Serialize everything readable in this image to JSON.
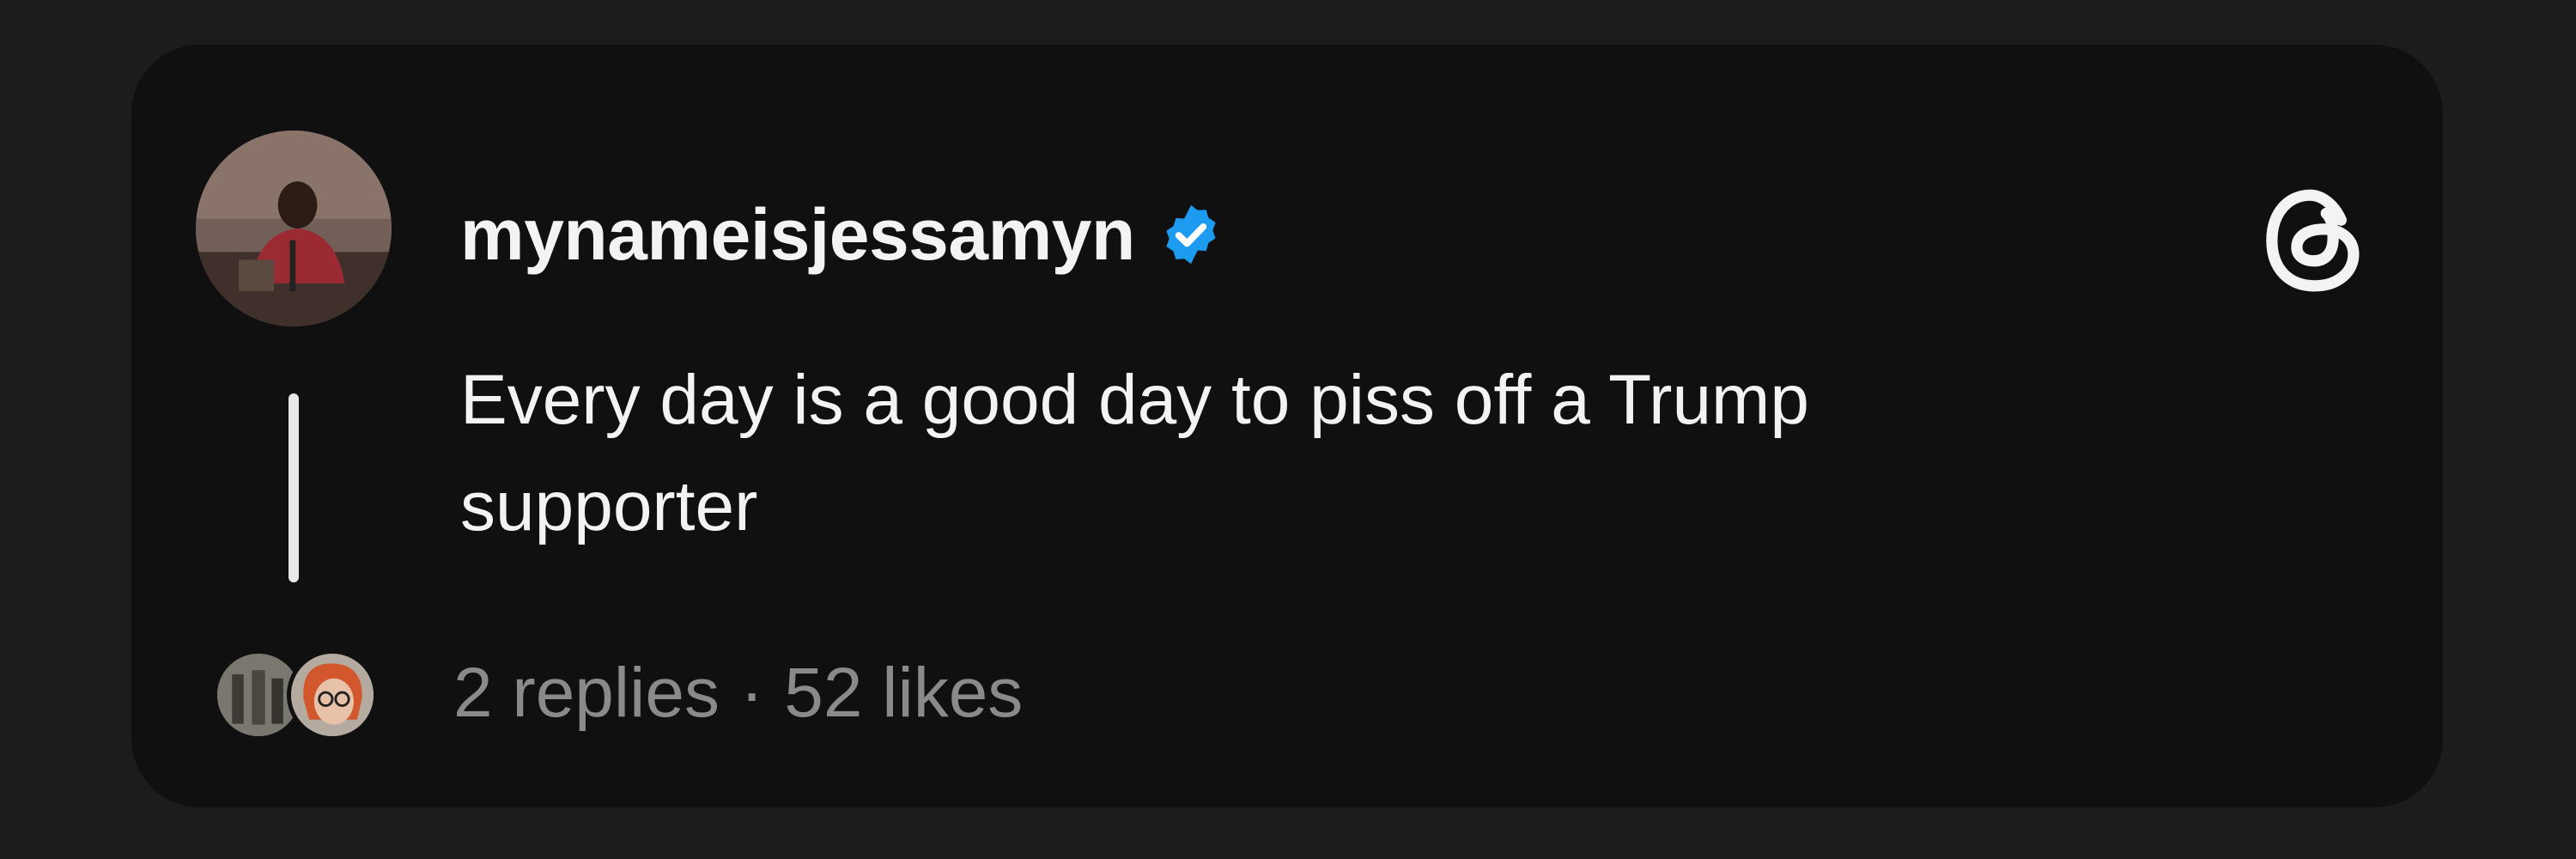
{
  "post": {
    "username": "mynameisjessamyn",
    "verified": true,
    "text_line1": "Every day is a good day to piss off a Trump",
    "text_line2": "supporter",
    "replies": "2 replies",
    "separator": "·",
    "likes": "52 likes"
  },
  "icons": {
    "verified_badge": "verified-check-icon",
    "brand_logo": "threads-logo-icon"
  },
  "colors": {
    "page_background": "#1c1c1c",
    "card_background": "#101010",
    "primary_text": "#f3f3f3",
    "secondary_text": "#8a8a8a",
    "verified_blue": "#1d9bf0"
  }
}
